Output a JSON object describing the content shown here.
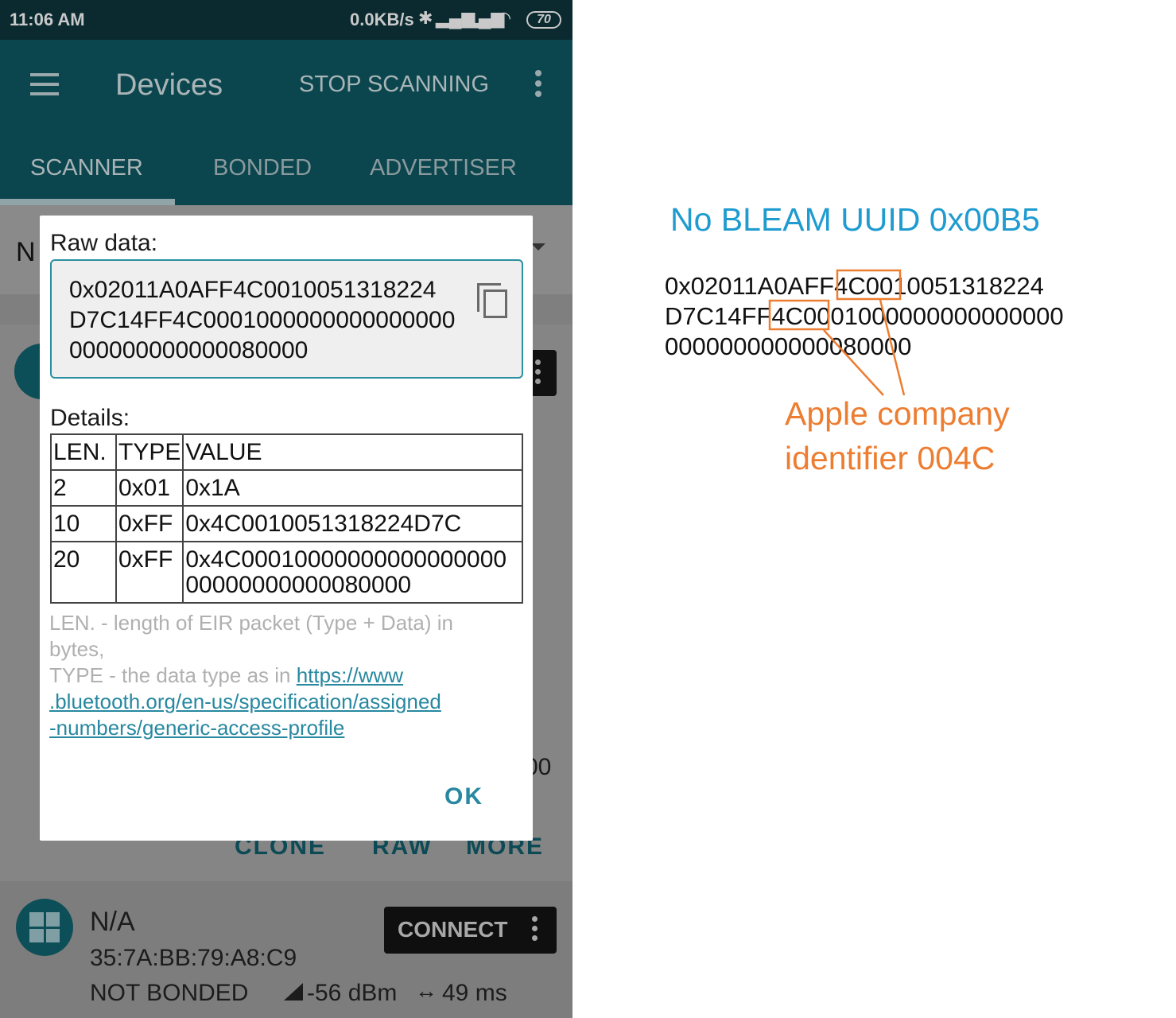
{
  "status_bar": {
    "time": "11:06 AM",
    "net_speed": "0.0KB/s",
    "battery": "70"
  },
  "app_bar": {
    "title": "Devices",
    "action": "STOP SCANNING"
  },
  "tabs": [
    {
      "label": "SCANNER",
      "active": true
    },
    {
      "label": "BONDED",
      "active": false
    },
    {
      "label": "ADVERTISER",
      "active": false
    }
  ],
  "filter": {
    "text_visible": "N"
  },
  "card1": {
    "fragments": [
      ":",
      ":",
      "00"
    ],
    "actions": [
      "CLONE",
      "RAW",
      "MORE"
    ]
  },
  "device": {
    "name": "N/A",
    "mac": "35:7A:BB:79:A8:C9",
    "bond_state": "NOT BONDED",
    "rssi": "-56 dBm",
    "interval": "49 ms",
    "connect_label": "CONNECT"
  },
  "dialog": {
    "raw_title": "Raw data:",
    "raw_lines": [
      "0x02011A0AFF4C0010051318224",
      "D7C14FF4C0001000000000000000",
      "000000000000080000"
    ],
    "details_title": "Details:",
    "columns": [
      "LEN.",
      "TYPE",
      "VALUE"
    ],
    "rows": [
      {
        "len": "2",
        "type": "0x01",
        "value": [
          "0x1A"
        ]
      },
      {
        "len": "10",
        "type": "0xFF",
        "value": [
          "0x4C0010051318224D7C"
        ]
      },
      {
        "len": "20",
        "type": "0xFF",
        "value": [
          "0x4C00010000000000000000",
          "00000000000080000"
        ]
      }
    ],
    "legend_len": "LEN. - length of EIR packet (Type + Data) in bytes,",
    "legend_type": "TYPE - the data type as in ",
    "link_lines": [
      "https://www",
      ".bluetooth.org/en-us/specification/assigned",
      "-numbers/generic-access-profile"
    ],
    "ok_label": "OK"
  },
  "annotation": {
    "title": "No BLEAM UUID 0x00B5",
    "raw_lines": [
      "0x02011A0AFF4C0010051318224",
      "D7C14FF4C0001000000000000000",
      "000000000000080000"
    ],
    "note_lines": [
      "Apple company",
      "identifier 004C"
    ],
    "colors": {
      "title": "#1f9bd0",
      "note": "#ed7d31",
      "app_bar": "#0b464f",
      "accent": "#2788a0"
    }
  }
}
